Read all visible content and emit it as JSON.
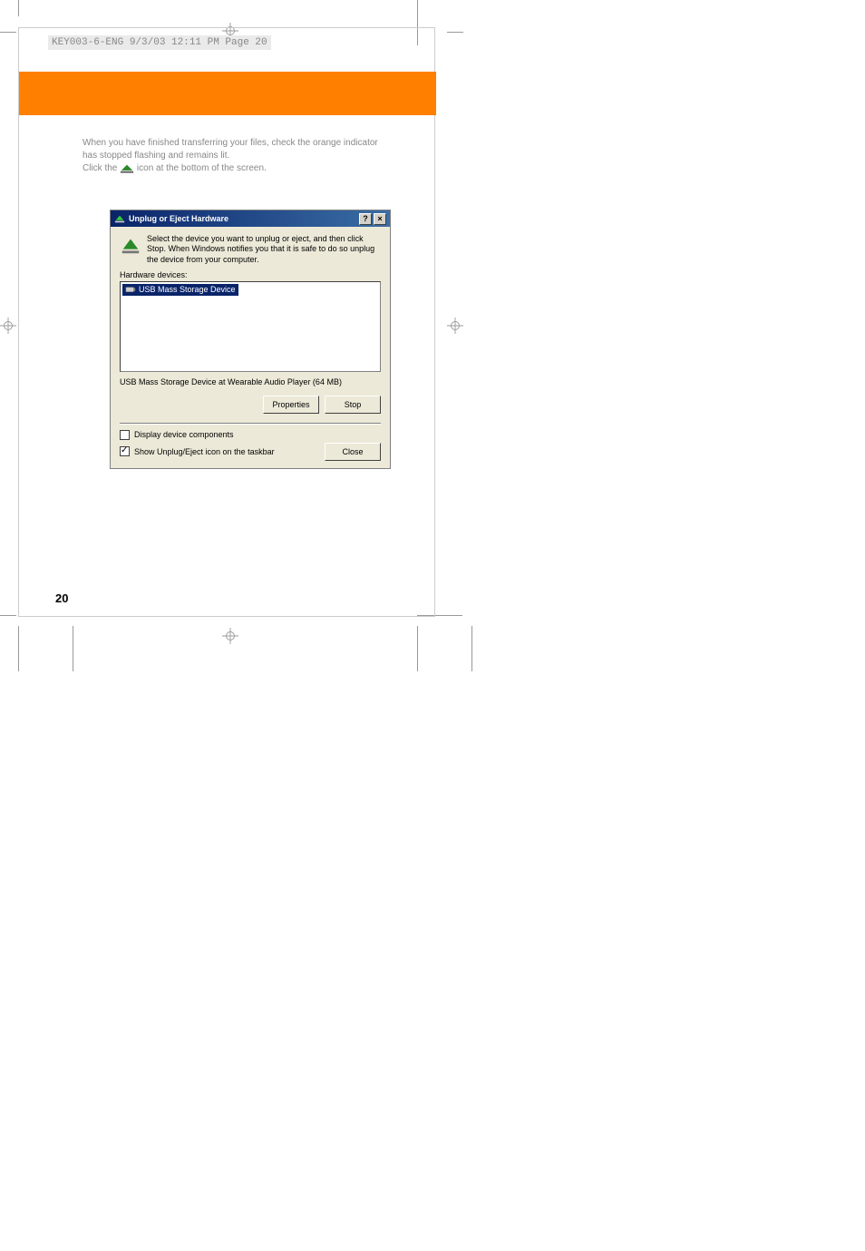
{
  "header_label": "KEY003-6-ENG  9/3/03  12:11 PM  Page 20",
  "body": {
    "para1": "When you have finished transferring your files, check the orange indicator has stopped flashing and remains lit.",
    "click_the": "Click the",
    "icon_tail": " icon at the bottom of the screen."
  },
  "dialog": {
    "title": "Unplug or Eject Hardware",
    "info": "Select the device you want to unplug or eject, and then click Stop. When Windows notifies you that it is safe to do so unplug the device from your computer.",
    "hardware_label": "Hardware devices:",
    "device_item": "USB Mass Storage Device",
    "desc": "USB Mass Storage Device at Wearable Audio Player (64 MB)",
    "btn_properties": "Properties",
    "btn_stop": "Stop",
    "check1": "Display device components",
    "check2": "Show Unplug/Eject icon on the taskbar",
    "btn_close": "Close"
  },
  "page_number": "20"
}
